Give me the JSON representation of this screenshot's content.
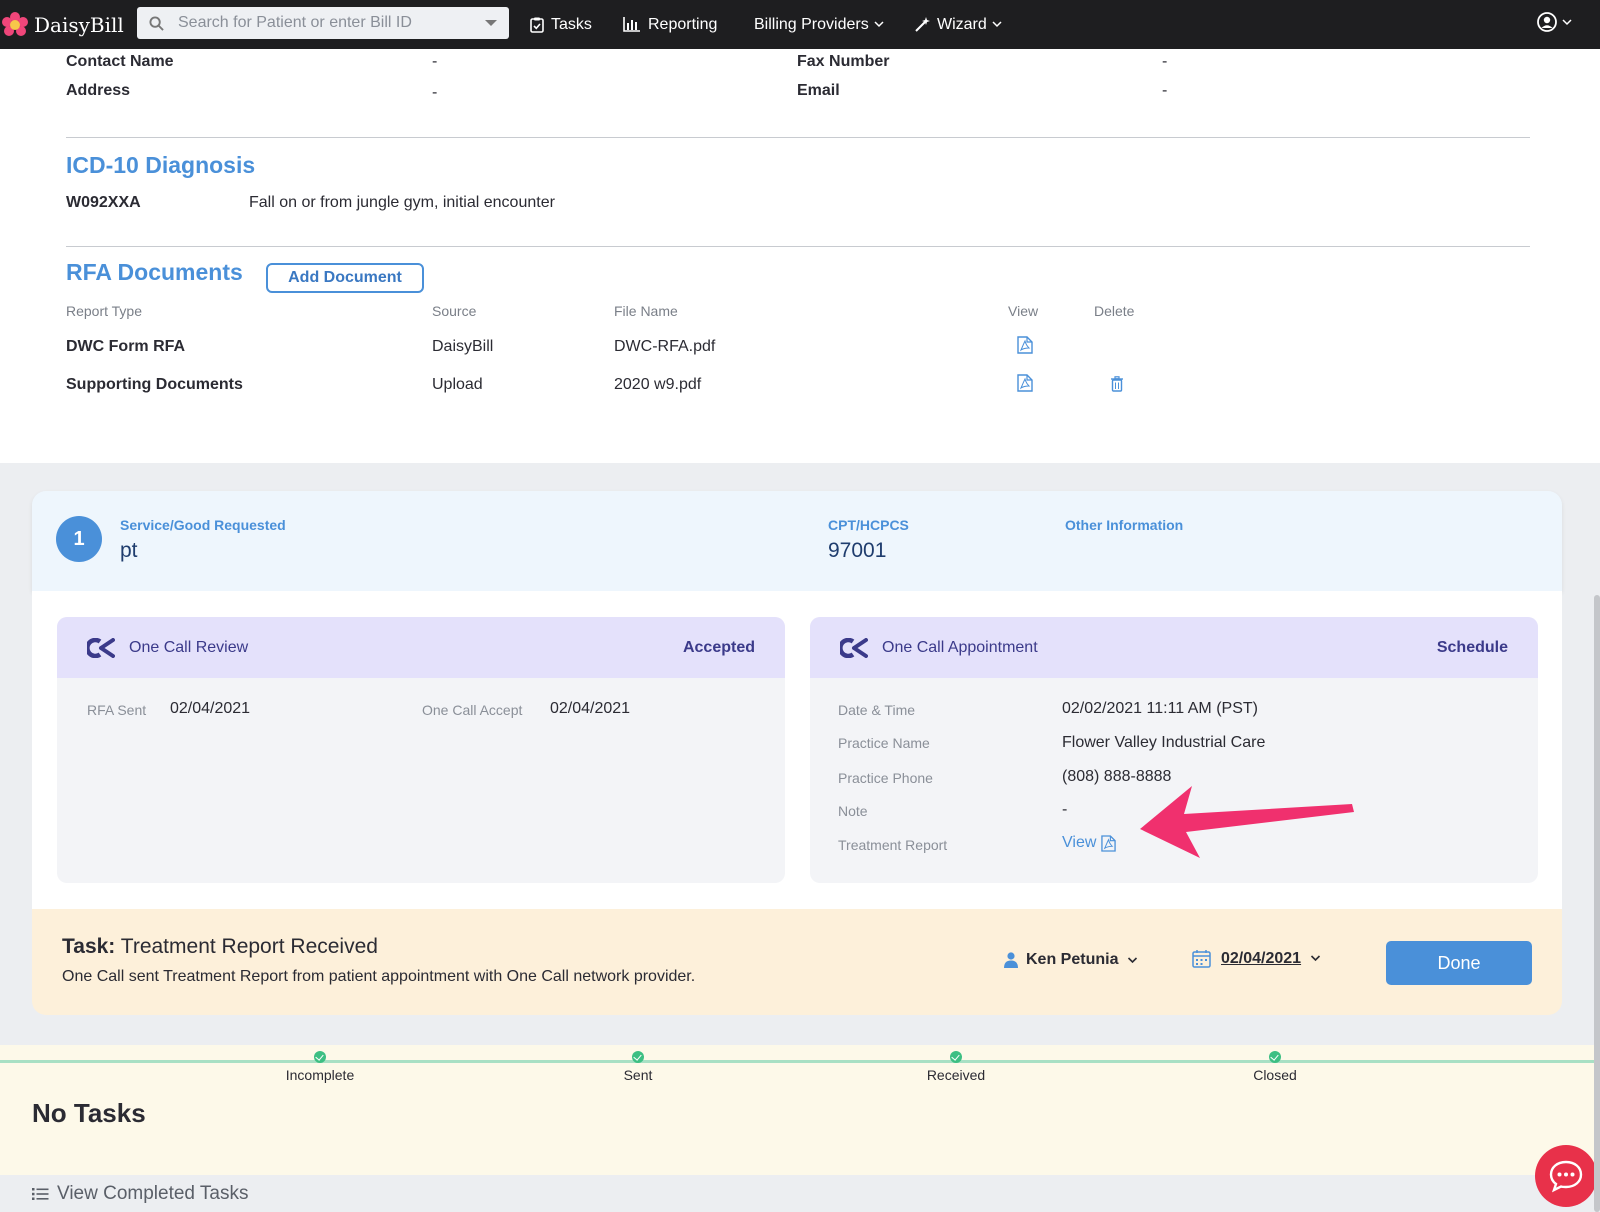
{
  "nav": {
    "brand": "DaisyBill",
    "search_placeholder": "Search for Patient or enter Bill ID",
    "tasks": "Tasks",
    "reporting": "Reporting",
    "billing_providers": "Billing Providers",
    "wizard": "Wizard"
  },
  "contact": {
    "contact_name_label": "Contact Name",
    "contact_name_value": "-",
    "address_label": "Address",
    "address_value": "-",
    "fax_label": "Fax Number",
    "fax_value": "-",
    "email_label": "Email",
    "email_value": "-"
  },
  "diagnosis": {
    "title": "ICD-10 Diagnosis",
    "code": "W092XXA",
    "description": "Fall on or from jungle gym, initial encounter"
  },
  "rfa": {
    "title": "RFA Documents",
    "add_button": "Add Document",
    "columns": [
      "Report Type",
      "Source",
      "File Name",
      "View",
      "Delete"
    ],
    "rows": [
      {
        "type": "DWC Form RFA",
        "source": "DaisyBill",
        "file": "DWC-RFA.pdf"
      },
      {
        "type": "Supporting Documents",
        "source": "Upload",
        "file": "2020 w9.pdf"
      }
    ]
  },
  "service": {
    "number": "1",
    "requested_label": "Service/Good Requested",
    "requested_value": "pt",
    "cpt_label": "CPT/HCPCS",
    "cpt_value": "97001",
    "other_label": "Other Information"
  },
  "review": {
    "title": "One Call Review",
    "status": "Accepted",
    "rfa_sent_label": "RFA Sent",
    "rfa_sent_value": "02/04/2021",
    "accept_label": "One Call Accept",
    "accept_value": "02/04/2021"
  },
  "appointment": {
    "title": "One Call Appointment",
    "status": "Schedule",
    "datetime_label": "Date & Time",
    "datetime_value": "02/02/2021 11:11 AM (PST)",
    "practice_label": "Practice Name",
    "practice_value": "Flower Valley Industrial Care",
    "phone_label": "Practice Phone",
    "phone_value": "(808) 888-8888",
    "note_label": "Note",
    "note_value": "-",
    "report_label": "Treatment Report",
    "report_link": "View"
  },
  "task": {
    "prefix": "Task:",
    "title": "Treatment Report Received",
    "description": "One Call sent Treatment Report from patient appointment with One Call network provider.",
    "assignee": "Ken Petunia",
    "due_date": "02/04/2021",
    "done_button": "Done"
  },
  "progress": {
    "steps": [
      "Incomplete",
      "Sent",
      "Received",
      "Closed"
    ]
  },
  "lower": {
    "no_tasks": "No Tasks",
    "view_completed": "View Completed Tasks"
  },
  "colors": {
    "accent": "#4a90d9",
    "nav_bg": "#1e1e20",
    "panel_header": "#e4e1fb",
    "task_bg": "#fdf0da",
    "arrow": "#f0306e",
    "chat": "#e8314a"
  }
}
